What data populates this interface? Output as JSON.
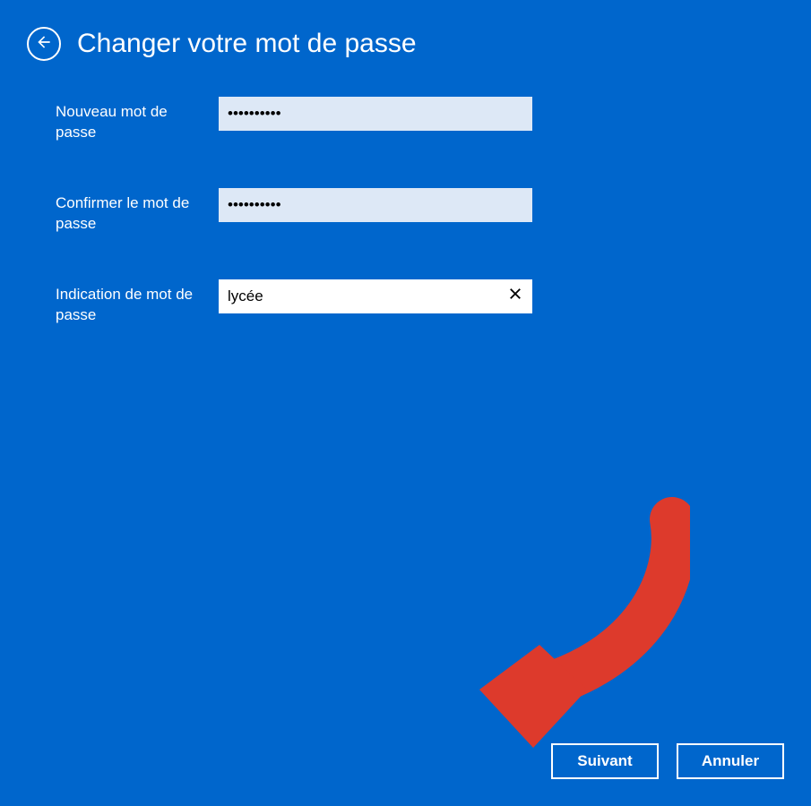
{
  "header": {
    "title": "Changer votre mot de passe"
  },
  "form": {
    "newPassword": {
      "label": "Nouveau mot de passe",
      "value": "••••••••••"
    },
    "confirmPassword": {
      "label": "Confirmer le mot de passe",
      "value": "••••••••••"
    },
    "hint": {
      "label": "Indication de mot de passe",
      "value": "lycée"
    }
  },
  "buttons": {
    "next": "Suivant",
    "cancel": "Annuler"
  },
  "colors": {
    "background": "#0066CC",
    "inputFilled": "#DDE8F6",
    "annotation": "#DD3A2C"
  }
}
